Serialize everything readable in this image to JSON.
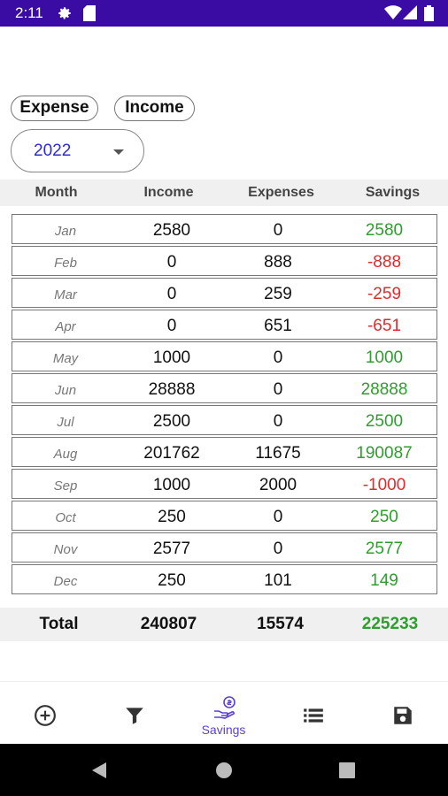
{
  "status_bar": {
    "time": "2:11",
    "icons": [
      "gear-icon",
      "sd-card-icon",
      "wifi-icon",
      "signal-icon",
      "battery-icon"
    ]
  },
  "chips": {
    "expense": "Expense",
    "income": "Income"
  },
  "year_select": {
    "value": "2022"
  },
  "table": {
    "headers": {
      "month": "Month",
      "income": "Income",
      "expenses": "Expenses",
      "savings": "Savings"
    },
    "rows": [
      {
        "month": "Jan",
        "income": "2580",
        "expenses": "0",
        "savings": "2580",
        "sign": "pos"
      },
      {
        "month": "Feb",
        "income": "0",
        "expenses": "888",
        "savings": "-888",
        "sign": "neg"
      },
      {
        "month": "Mar",
        "income": "0",
        "expenses": "259",
        "savings": "-259",
        "sign": "neg"
      },
      {
        "month": "Apr",
        "income": "0",
        "expenses": "651",
        "savings": "-651",
        "sign": "neg"
      },
      {
        "month": "May",
        "income": "1000",
        "expenses": "0",
        "savings": "1000",
        "sign": "pos"
      },
      {
        "month": "Jun",
        "income": "28888",
        "expenses": "0",
        "savings": "28888",
        "sign": "pos"
      },
      {
        "month": "Jul",
        "income": "2500",
        "expenses": "0",
        "savings": "2500",
        "sign": "pos"
      },
      {
        "month": "Aug",
        "income": "201762",
        "expenses": "11675",
        "savings": "190087",
        "sign": "pos"
      },
      {
        "month": "Sep",
        "income": "1000",
        "expenses": "2000",
        "savings": "-1000",
        "sign": "neg"
      },
      {
        "month": "Oct",
        "income": "250",
        "expenses": "0",
        "savings": "250",
        "sign": "pos"
      },
      {
        "month": "Nov",
        "income": "2577",
        "expenses": "0",
        "savings": "2577",
        "sign": "pos"
      },
      {
        "month": "Dec",
        "income": "250",
        "expenses": "101",
        "savings": "149",
        "sign": "pos"
      }
    ],
    "total": {
      "label": "Total",
      "income": "240807",
      "expenses": "15574",
      "savings": "225233"
    }
  },
  "bottom_nav": {
    "items": [
      {
        "icon": "add-circle-icon"
      },
      {
        "icon": "filter-icon"
      },
      {
        "icon": "savings-icon",
        "label": "Savings",
        "active": true
      },
      {
        "icon": "list-icon"
      },
      {
        "icon": "save-icon"
      }
    ]
  },
  "colors": {
    "status_bar": "#3a0ca3",
    "accent": "#5b3fd6",
    "positive": "#2e9e2e",
    "negative": "#e02b2b",
    "year": "#2b2bd8"
  }
}
